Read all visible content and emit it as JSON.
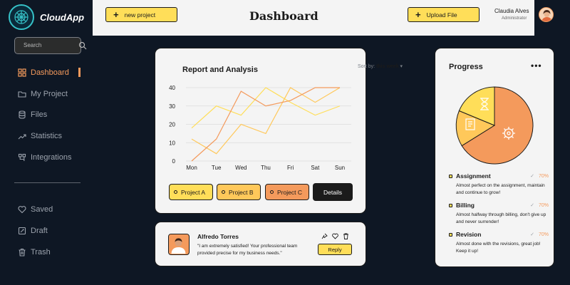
{
  "brand": {
    "name": "CloudApp"
  },
  "search": {
    "placeholder": "Search"
  },
  "sidebar": {
    "items": [
      {
        "label": "Dashboard",
        "icon": "grid-icon",
        "active": true
      },
      {
        "label": "My Project",
        "icon": "folder-icon"
      },
      {
        "label": "Files",
        "icon": "database-icon"
      },
      {
        "label": "Statistics",
        "icon": "trend-icon"
      },
      {
        "label": "Integrations",
        "icon": "puzzle-icon"
      }
    ],
    "secondary": [
      {
        "label": "Saved",
        "icon": "heart-icon"
      },
      {
        "label": "Draft",
        "icon": "draft-icon"
      },
      {
        "label": "Trash",
        "icon": "trash-icon"
      }
    ]
  },
  "header": {
    "new_project": "new project",
    "title": "Dashboard",
    "upload": "Upload File",
    "user_name": "Claudia Alves",
    "user_role": "Administrator"
  },
  "report": {
    "title": "Report and Analysis",
    "sort_prefix": "Sort by:",
    "sort_value": "this week",
    "details": "Details",
    "legend": [
      "Project A",
      "Project B",
      "Project C"
    ]
  },
  "chart_data": {
    "type": "line",
    "categories": [
      "Mon",
      "Tue",
      "Wed",
      "Thu",
      "Fri",
      "Sat",
      "Sun"
    ],
    "ylim": [
      0,
      40
    ],
    "yticks": [
      0,
      10,
      20,
      30,
      40
    ],
    "grid": true,
    "series": [
      {
        "name": "Project A",
        "color": "#ffde59",
        "values": [
          18,
          30,
          25,
          40,
          32,
          25,
          30
        ]
      },
      {
        "name": "Project B",
        "color": "#ffc85a",
        "values": [
          12,
          4,
          20,
          15,
          40,
          32,
          40
        ]
      },
      {
        "name": "Project C",
        "color": "#f49a5c",
        "values": [
          0,
          12,
          38,
          30,
          33,
          40,
          40
        ]
      }
    ]
  },
  "review": {
    "name": "Alfredo Torres",
    "text": "\"I am extremely satisfied! Your professional team provided precise for my business needs.\"",
    "reply": "Reply"
  },
  "progress": {
    "title": "Progress",
    "items": [
      {
        "label": "Assignment",
        "pct": "70%",
        "desc": "Almost perfect on the assignment, maintain and continue to grow!"
      },
      {
        "label": "Billing",
        "pct": "70%",
        "desc": "Almost halfway through billing, don't give up and never surrender!"
      },
      {
        "label": "Revision",
        "pct": "70%",
        "desc": "Almost done with the revisions, great job! Keep it up!"
      }
    ],
    "pie_colors": [
      "#f49a5c",
      "#ffc85a",
      "#ffde59"
    ]
  }
}
